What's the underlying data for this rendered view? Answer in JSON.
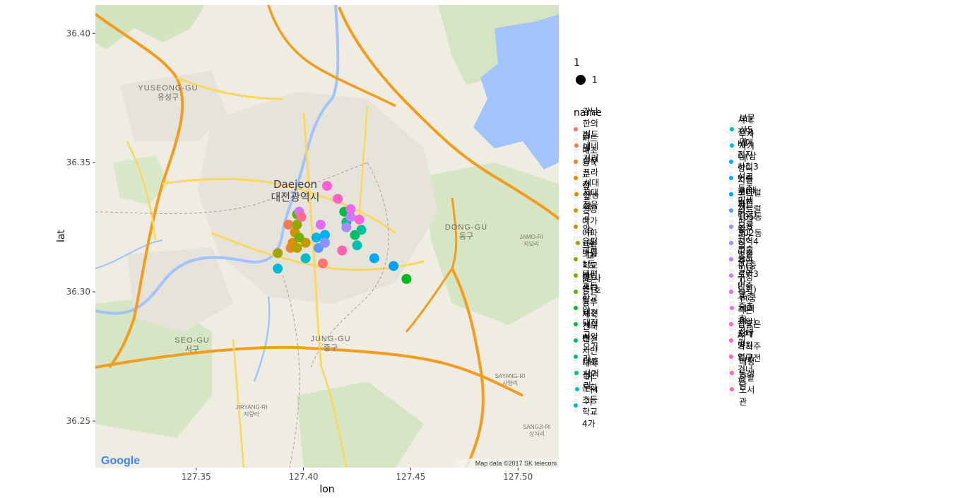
{
  "chart_data": {
    "type": "scatter",
    "title": "",
    "xlabel": "lon",
    "ylabel": "lat",
    "xlim": [
      127.303,
      127.519
    ],
    "ylim": [
      36.232,
      36.411
    ],
    "x_ticks": [
      "127.35",
      "127.40",
      "127.45",
      "127.50"
    ],
    "x_tick_values": [
      127.35,
      127.4,
      127.45,
      127.5
    ],
    "y_ticks": [
      "36.25",
      "36.30",
      "36.35",
      "36.40"
    ],
    "y_tick_values": [
      36.25,
      36.3,
      36.35,
      36.4
    ],
    "size_legend": {
      "title": "1",
      "label": "1"
    },
    "color_legend_title": "name",
    "map": {
      "attribution": "Map data ©2017 SK telecom",
      "google": "Google",
      "city_en": "Daejeon",
      "city_ko": "대전광역시",
      "labels": [
        {
          "en": "YUSEONG-GU",
          "ko": "유성구"
        },
        {
          "en": "DONG-GU",
          "ko": "동구"
        },
        {
          "en": "SEO-GU",
          "ko": "서구"
        },
        {
          "en": "JUNG-GU",
          "ko": "중구"
        },
        {
          "en": "JAMO-RI",
          "ko": "지모리"
        },
        {
          "en": "SAYANG-RI",
          "ko": "사양리"
        },
        {
          "en": "JIRYANG-RI",
          "ko": "지량리"
        },
        {
          "en": "SANGJI-RI",
          "ko": "상지리"
        }
      ]
    },
    "series": [
      {
        "name": "강남한의원 앞",
        "color": "#F8766D",
        "x": 127.409,
        "y": 36.311
      },
      {
        "name": "버드내네거리",
        "color": "#F17D51",
        "x": 127.393,
        "y": 36.326
      },
      {
        "name": "버드내초등학교 앞",
        "color": "#E8852E",
        "x": 127.394,
        "y": 36.317
      },
      {
        "name": "삼부프라자 앞",
        "color": "#DE8C00",
        "x": 127.395,
        "y": 36.319
      },
      {
        "name": "서대전농협",
        "color": "#D39200",
        "x": 127.396,
        "y": 36.323
      },
      {
        "name": "서대전육교 앞",
        "color": "#C59900",
        "x": 127.401,
        "y": 36.319
      },
      {
        "name": "쌍용예가아파트앞",
        "color": "#B69F00",
        "x": 127.397,
        "y": 36.317
      },
      {
        "name": "유등교",
        "color": "#A3A500",
        "x": 127.388,
        "y": 36.315
      },
      {
        "name": "유평초등학교 앞",
        "color": "#8EAA00",
        "x": 127.397,
        "y": 36.326
      },
      {
        "name": "태평1동 주민센터 앞",
        "color": "#75AF00",
        "x": 127.398,
        "y": 36.321
      },
      {
        "name": "태평초등학교 앞",
        "color": "#53B400",
        "x": 127.397,
        "y": 36.33
      },
      {
        "name": "[공사중]호동우체국 건너편",
        "color": "#00B81F",
        "x": 127.448,
        "y": 36.305
      },
      {
        "name": "대전 세무서앞",
        "color": "#00BB44",
        "x": 127.419,
        "y": 36.331
      },
      {
        "name": "대전고 오거리",
        "color": "#00BE63",
        "x": 127.424,
        "y": 36.322
      },
      {
        "name": "대전시민대학 정문",
        "color": "#00C081",
        "x": 127.42,
        "y": 36.327
      },
      {
        "name": "대흥 사거리",
        "color": "#00C19A",
        "x": 127.427,
        "y": 36.324
      },
      {
        "name": "머티4가",
        "color": "#00C0B2",
        "x": 127.425,
        "y": 36.318
      },
      {
        "name": "문화초등학교4가",
        "color": "#00BDC4",
        "x": 127.401,
        "y": 36.313
      },
      {
        "name": "보문산5가",
        "color": "#00B9D7",
        "x": 127.388,
        "y": 36.309
      },
      {
        "name": "부사 사거리",
        "color": "#00B5E6",
        "x": 127.406,
        "y": 36.321
      },
      {
        "name": "서대전역네거리(삼성디지털 프라자)",
        "color": "#00AFF3",
        "x": 127.41,
        "y": 36.322
      },
      {
        "name": "서대전지하철3번출구(대순진리회)",
        "color": "#00A8FF",
        "x": 127.433,
        "y": 36.313
      },
      {
        "name": "석교동주민센터",
        "color": "#00A0FF",
        "x": 127.442,
        "y": 36.31
      },
      {
        "name": "센트럴파크 105동 앞",
        "color": "#5E9BFF",
        "x": 127.407,
        "y": 36.317
      },
      {
        "name": "센트럴파크 302동 앞",
        "color": "#8F91FF",
        "x": 127.41,
        "y": 36.319
      },
      {
        "name": "오룡역7번출구",
        "color": "#A68BFF",
        "x": 127.42,
        "y": 36.325
      },
      {
        "name": "중구청역4번출구(중구청의회)",
        "color": "#C77CFF",
        "x": 127.422,
        "y": 36.329
      },
      {
        "name": "중도일보사 앞",
        "color": "#D474FF",
        "x": 127.398,
        "y": 36.331
      },
      {
        "name": "중앙로역3번출구(궁측본점앞)",
        "color": "#DE6DFF",
        "x": 127.408,
        "y": 36.326
      },
      {
        "name": "중촌네거리",
        "color": "#EC67F2",
        "x": 127.422,
        "y": 36.332
      },
      {
        "name": "중촌초 건너편",
        "color": "#F564E3",
        "x": 127.426,
        "y": 36.328
      },
      {
        "name": "참좋은APT 가자주류대전",
        "color": "#FA62D1",
        "x": 127.411,
        "y": 36.341
      },
      {
        "name": "충대병원입구 건너편",
        "color": "#FE61C0",
        "x": 127.416,
        "y": 36.336
      },
      {
        "name": "태평동성당",
        "color": "#FF62AE",
        "x": 127.418,
        "y": 36.316
      },
      {
        "name": "한밭도서관",
        "color": "#FF6C91",
        "x": 127.399,
        "y": 36.329
      }
    ]
  }
}
